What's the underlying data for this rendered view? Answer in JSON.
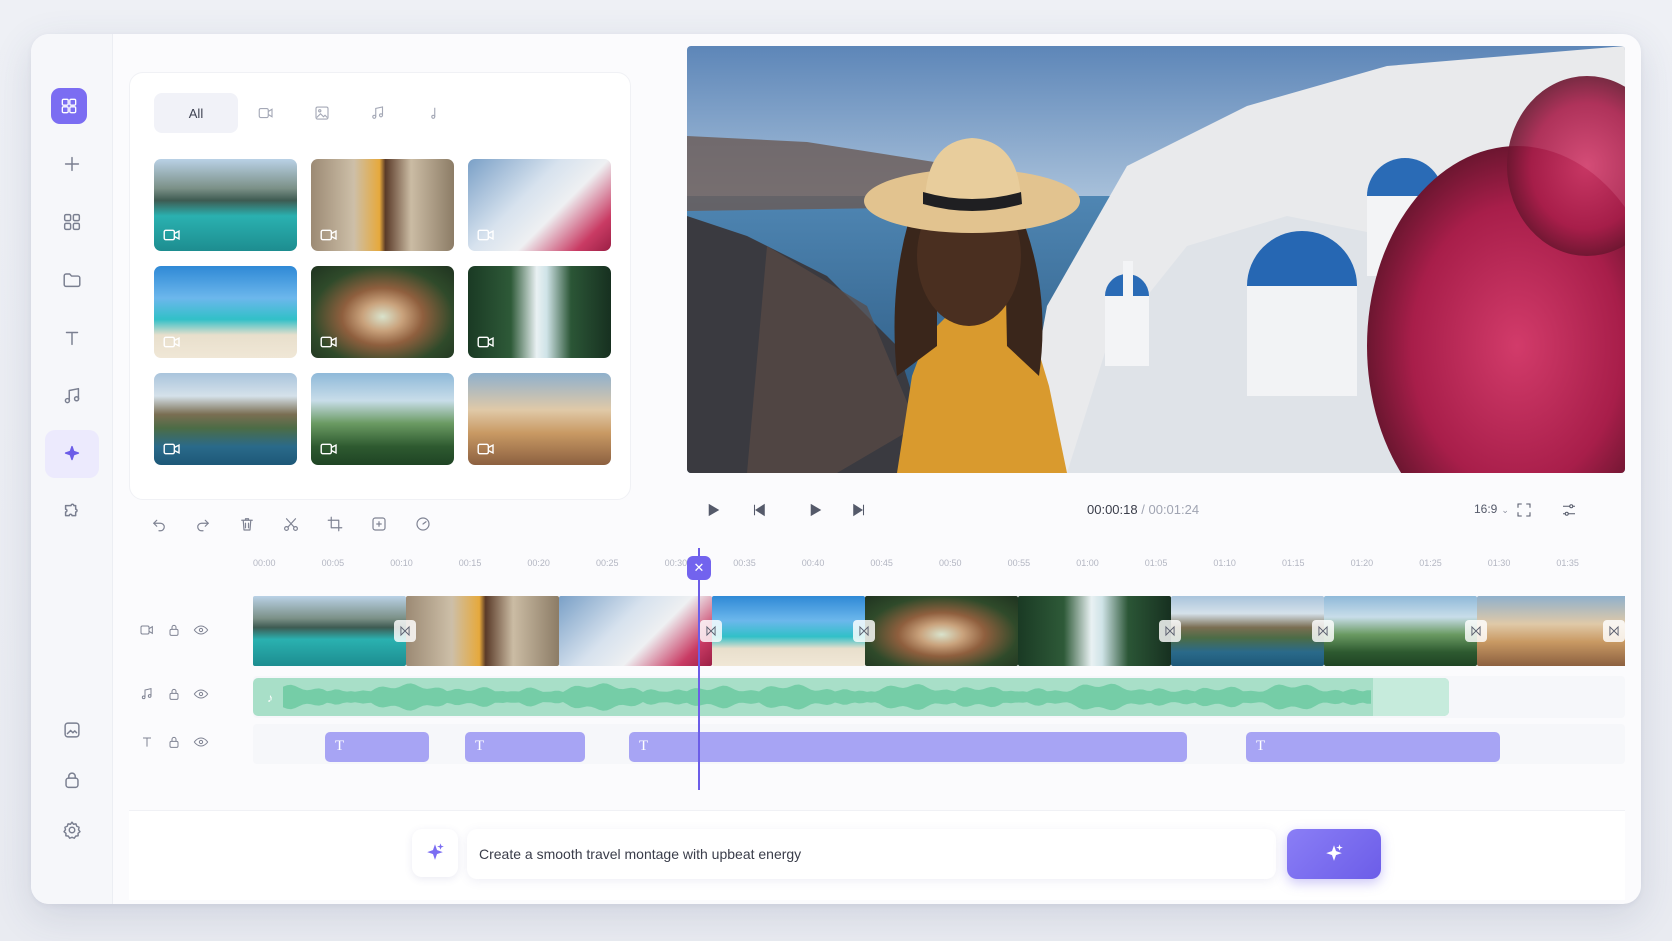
{
  "window": {
    "controls": [
      "close",
      "minimize",
      "maximize"
    ],
    "colors": {
      "close": "#ee5f59",
      "minimize": "#f4be43",
      "maximize": "#5fc63f"
    }
  },
  "sidebar": {
    "items": [
      {
        "icon": "logo-grid-icon"
      },
      {
        "icon": "plus-icon"
      },
      {
        "icon": "apps-icon"
      },
      {
        "icon": "folder-icon"
      },
      {
        "icon": "text-icon"
      },
      {
        "icon": "music-icon"
      },
      {
        "icon": "ai-sparkle-icon",
        "active": true
      },
      {
        "icon": "puzzle-icon"
      },
      {
        "icon": "image-icon"
      },
      {
        "icon": "lock-icon"
      },
      {
        "icon": "settings-icon"
      }
    ]
  },
  "media": {
    "filters": {
      "all_label": "All",
      "icons": [
        "video-icon",
        "image-icon",
        "music-icon",
        "audio-note-icon"
      ]
    },
    "thumbnails": [
      {
        "subject": "mountain lake with boat",
        "type": "video"
      },
      {
        "subject": "woman in hat on street",
        "type": "video"
      },
      {
        "subject": "santorini with flowers",
        "type": "video"
      },
      {
        "subject": "tropical beach with palm",
        "type": "video"
      },
      {
        "subject": "stone archway",
        "type": "video"
      },
      {
        "subject": "jungle waterfall",
        "type": "video"
      },
      {
        "subject": "coastal cliffs",
        "type": "video"
      },
      {
        "subject": "jungle swing",
        "type": "video"
      },
      {
        "subject": "hot air balloons",
        "type": "video"
      }
    ]
  },
  "player": {
    "current_time": "00:00:18",
    "separator": "/",
    "total_time": "00:01:24",
    "aspect_ratio": "16:9"
  },
  "timeline": {
    "ruler_ticks": [
      "00:00",
      "00:05",
      "00:10",
      "00:15",
      "00:20",
      "00:25",
      "00:30",
      "00:35",
      "00:40",
      "00:45",
      "00:50",
      "00:55",
      "01:00",
      "01:05",
      "01:10",
      "01:15",
      "01:20",
      "01:25",
      "01:30",
      "01:35"
    ],
    "text_clips_label": "T",
    "audio_label": "♪"
  },
  "prompt": {
    "value": "Create a smooth travel montage with upbeat energy"
  }
}
